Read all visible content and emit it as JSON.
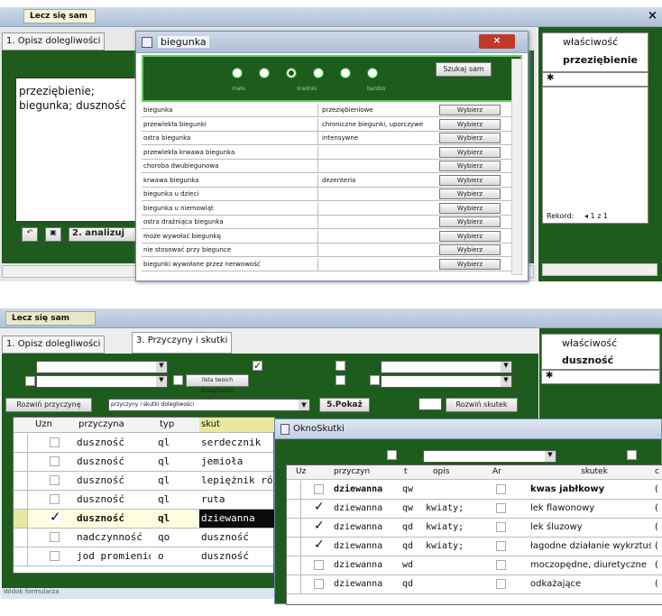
{
  "top": {
    "app_tab": "Lecz się sam",
    "close_glyph": "×",
    "tab1": "1. Opisz dolegliwości",
    "symptoms": [
      "przeziębienie;",
      "biegunka; duszność"
    ],
    "analyze_button": "2. analizuj",
    "props": {
      "col": "właściwość",
      "value": "przeziębienie",
      "row_marker": "✱",
      "record_label": "Rekord:",
      "record_nav": "◂ 1 z 1"
    },
    "dialog": {
      "title": "biegunka",
      "close_glyph": "×",
      "search_button": "Szukaj sam",
      "dot_labels": [
        "mało",
        "średnio",
        "bardzo"
      ],
      "select_label": "Wybierz",
      "rows": [
        {
          "name": "biegunka",
          "info": "przeziębieniowe"
        },
        {
          "name": "przewlekła biegunki",
          "info": "chroniczne biegunki, uporczywe"
        },
        {
          "name": "ostra biegunka",
          "info": "intensywne"
        },
        {
          "name": "przewlekła krwawa biegunka",
          "info": ""
        },
        {
          "name": "choroba dwubiegunowa",
          "info": ""
        },
        {
          "name": "krwawa biegunka",
          "info": "dezenteria"
        },
        {
          "name": "biegunka u dzieci",
          "info": ""
        },
        {
          "name": "biegunka u niemowląt",
          "info": ""
        },
        {
          "name": "ostra drażniąca biegunka",
          "info": ""
        },
        {
          "name": "może wywołać biegunkę",
          "info": ""
        },
        {
          "name": "nie stosować przy biegunce",
          "info": ""
        },
        {
          "name": "biegunki wywołane przez nerwowość",
          "info": ""
        }
      ]
    }
  },
  "bottom": {
    "app_tab": "Lecz się sam",
    "tabs": [
      "1. Opisz dolegliwości",
      "3. Przyczyny i skutki"
    ],
    "filter_button": "lista twoich dolegliwości",
    "expand_cause_button": "Rozwiń przyczynę",
    "combo_value": "przyczyny i skutki dolegliwości",
    "show_button": "5.Pokaż",
    "expand_effect_button": "Rozwiń skutek",
    "props": {
      "col": "właściwość",
      "value": "duszność",
      "row_marker": "✱"
    },
    "grid": {
      "headers": [
        "Uzn",
        "przyczyna",
        "typ",
        "skut"
      ],
      "rows": [
        {
          "checked": false,
          "cause": "duszność",
          "type": "ql",
          "effect": "serdecznik"
        },
        {
          "checked": false,
          "cause": "duszność",
          "type": "ql",
          "effect": "jemioła"
        },
        {
          "checked": false,
          "cause": "duszność",
          "type": "ql",
          "effect": "lepiężnik różowy"
        },
        {
          "checked": false,
          "cause": "duszność",
          "type": "ql",
          "effect": "ruta"
        },
        {
          "checked": true,
          "cause": "duszność",
          "type": "ql",
          "effect": "dziewanna"
        },
        {
          "checked": false,
          "cause": "nadczynność",
          "type": "qo",
          "effect": "duszność"
        },
        {
          "checked": false,
          "cause": "jod promieniotwórczy",
          "type": "o",
          "effect": "duszność"
        }
      ]
    },
    "status": "Widok formularza",
    "popup": {
      "title": "OknoSkutki",
      "headers": [
        "Uz",
        "przyczyn",
        "t",
        "opis",
        "Ar",
        "skutek",
        "c"
      ],
      "rows": [
        {
          "checked": false,
          "cause": "dziewanna",
          "t": "qw",
          "desc": "",
          "effect": "kwas jabłkowy",
          "bold": true,
          "c": "("
        },
        {
          "checked": true,
          "cause": "dziewanna",
          "t": "qw",
          "desc": "kwiaty;",
          "effect": "lek flawonowy",
          "bold": false,
          "c": "("
        },
        {
          "checked": true,
          "cause": "dziewanna",
          "t": "qd",
          "desc": "kwiaty;",
          "effect": "lek śluzowy",
          "bold": false,
          "c": "("
        },
        {
          "checked": true,
          "cause": "dziewanna",
          "t": "qd",
          "desc": "kwiaty;",
          "effect": "łagodne działanie wykrztuśne",
          "bold": false,
          "c": "("
        },
        {
          "checked": false,
          "cause": "dziewanna",
          "t": "wd",
          "desc": "",
          "effect": "moczopędne, diuretyczne",
          "bold": false,
          "c": "("
        },
        {
          "checked": false,
          "cause": "dziewanna",
          "t": "qd",
          "desc": "",
          "effect": "odkażające",
          "bold": false,
          "c": "("
        }
      ]
    }
  }
}
